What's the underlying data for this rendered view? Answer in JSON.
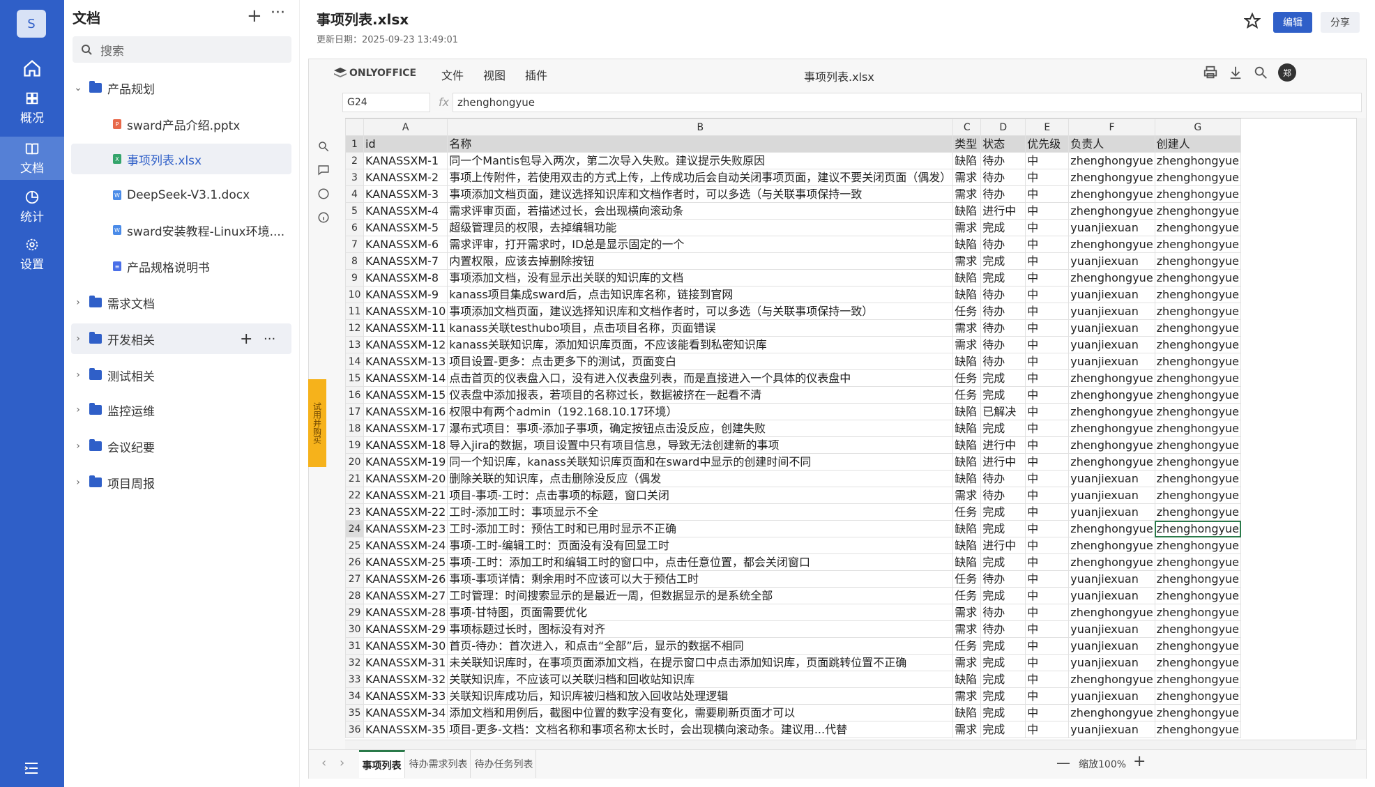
{
  "nav": {
    "logo": "S",
    "items": [
      {
        "label": "",
        "icon": "home-icon"
      },
      {
        "label": "概况",
        "icon": "overview-icon"
      },
      {
        "label": "文档",
        "icon": "book-icon"
      },
      {
        "label": "统计",
        "icon": "pie-chart-icon"
      },
      {
        "label": "设置",
        "icon": "gear-icon"
      }
    ]
  },
  "sidebar": {
    "title": "文档",
    "search_placeholder": "搜索",
    "items": [
      {
        "label": "产品规划",
        "type": "folder",
        "expanded": true
      },
      {
        "label": "sward产品介绍.pptx",
        "type": "pptx"
      },
      {
        "label": "事项列表.xlsx",
        "type": "xlsx",
        "selected": true
      },
      {
        "label": "DeepSeek-V3.1.docx",
        "type": "docx"
      },
      {
        "label": "sward安装教程-Linux环境....",
        "type": "docx"
      },
      {
        "label": "产品规格说明书",
        "type": "doc"
      },
      {
        "label": "需求文档",
        "type": "folder"
      },
      {
        "label": "开发相关",
        "type": "folder",
        "hover": true
      },
      {
        "label": "测试相关",
        "type": "folder"
      },
      {
        "label": "监控运维",
        "type": "folder"
      },
      {
        "label": "会议纪要",
        "type": "folder"
      },
      {
        "label": "项目周报",
        "type": "folder"
      }
    ]
  },
  "header": {
    "title": "事项列表.xlsx",
    "date": "更新日期：2025-09-23 13:49:01",
    "edit": "编辑",
    "share": "分享"
  },
  "editor": {
    "brand": "ONLYOFFICE",
    "menu": [
      "文件",
      "视图",
      "插件"
    ],
    "doc_title": "事项列表.xlsx",
    "avatar": "郑",
    "cell_ref": "G24",
    "formula": "zhenghongyue",
    "side_tab": "试用并购买",
    "columns": [
      "A",
      "B",
      "C",
      "D",
      "E",
      "F"
    ],
    "header_row": [
      "id",
      "名称",
      "类型",
      "状态",
      "优先级",
      "负责人",
      "创建人"
    ],
    "rows": [
      [
        "KANASSXM-1",
        "同一个Mantis包导入两次，第二次导入失败。建议提示失败原因",
        "缺陷",
        "待办",
        "中",
        "zhenghongyue",
        "zhenghongyue"
      ],
      [
        "KANASSXM-2",
        "事项上传附件，若使用双击的方式上传，上传成功后会自动关闭事项页面，建议不要关闭页面（偶发）",
        "需求",
        "待办",
        "中",
        "zhenghongyue",
        "zhenghongyue"
      ],
      [
        "KANASSXM-3",
        "事项添加文档页面，建议选择知识库和文档作者时，可以多选（与关联事项保持一致",
        "需求",
        "待办",
        "中",
        "zhenghongyue",
        "zhenghongyue"
      ],
      [
        "KANASSXM-4",
        "需求评审页面，若描述过长，会出现横向滚动条",
        "缺陷",
        "进行中",
        "中",
        "zhenghongyue",
        "zhenghongyue"
      ],
      [
        "KANASSXM-5",
        "超级管理员的权限，去掉编辑功能",
        "需求",
        "完成",
        "中",
        "yuanjiexuan",
        "zhenghongyue"
      ],
      [
        "KANASSXM-6",
        "需求评审，打开需求时，ID总是显示固定的一个",
        "缺陷",
        "待办",
        "中",
        "zhenghongyue",
        "zhenghongyue"
      ],
      [
        "KANASSXM-7",
        "内置权限，应该去掉删除按钮",
        "需求",
        "完成",
        "中",
        "yuanjiexuan",
        "zhenghongyue"
      ],
      [
        "KANASSXM-8",
        "事项添加文档，没有显示出关联的知识库的文档",
        "缺陷",
        "完成",
        "中",
        "zhenghongyue",
        "zhenghongyue"
      ],
      [
        "KANASSXM-9",
        "kanass项目集成sward后，点击知识库名称，链接到官网",
        "缺陷",
        "待办",
        "中",
        "yuanjiexuan",
        "zhenghongyue"
      ],
      [
        "KANASSXM-10",
        "事项添加文档页面，建议选择知识库和文档作者时，可以多选（与关联事项保持一致）",
        "任务",
        "待办",
        "中",
        "yuanjiexuan",
        "zhenghongyue"
      ],
      [
        "KANASSXM-11",
        "kanass关联testhubo项目，点击项目名称，页面错误",
        "需求",
        "待办",
        "中",
        "yuanjiexuan",
        "zhenghongyue"
      ],
      [
        "KANASSXM-12",
        "kanass关联知识库，添加知识库页面，不应该能看到私密知识库",
        "需求",
        "待办",
        "中",
        "yuanjiexuan",
        "zhenghongyue"
      ],
      [
        "KANASSXM-13",
        "项目设置-更多：点击更多下的测试，页面变白",
        "缺陷",
        "待办",
        "中",
        "yuanjiexuan",
        "zhenghongyue"
      ],
      [
        "KANASSXM-14",
        "点击首页的仪表盘入口，没有进入仪表盘列表，而是直接进入一个具体的仪表盘中",
        "任务",
        "完成",
        "中",
        "zhenghongyue",
        "zhenghongyue"
      ],
      [
        "KANASSXM-15",
        "仪表盘中添加报表，若项目的名称过长，数据被挤在一起看不清",
        "任务",
        "完成",
        "中",
        "zhenghongyue",
        "zhenghongyue"
      ],
      [
        "KANASSXM-16",
        "权限中有两个admin（192.168.10.17环境）",
        "缺陷",
        "已解决",
        "中",
        "zhenghongyue",
        "zhenghongyue"
      ],
      [
        "KANASSXM-17",
        "瀑布式项目：事项-添加子事项，确定按钮点击没反应，创建失败",
        "缺陷",
        "完成",
        "中",
        "zhenghongyue",
        "zhenghongyue"
      ],
      [
        "KANASSXM-18",
        "导入jira的数据，项目设置中只有项目信息，导致无法创建新的事项",
        "缺陷",
        "进行中",
        "中",
        "zhenghongyue",
        "zhenghongyue"
      ],
      [
        "KANASSXM-19",
        "同一个知识库，kanass关联知识库页面和在sward中显示的创建时间不同",
        "缺陷",
        "进行中",
        "中",
        "zhenghongyue",
        "zhenghongyue"
      ],
      [
        "KANASSXM-20",
        "删除关联的知识库，点击删除没反应（偶发",
        "缺陷",
        "待办",
        "中",
        "yuanjiexuan",
        "zhenghongyue"
      ],
      [
        "KANASSXM-21",
        "项目-事项-工时：点击事项的标题，窗口关闭",
        "需求",
        "待办",
        "中",
        "yuanjiexuan",
        "zhenghongyue"
      ],
      [
        "KANASSXM-22",
        "工时-添加工时：事项显示不全",
        "任务",
        "完成",
        "中",
        "yuanjiexuan",
        "zhenghongyue"
      ],
      [
        "KANASSXM-23",
        "工时-添加工时：预估工时和已用时显示不正确",
        "缺陷",
        "完成",
        "中",
        "zhenghongyue",
        "zhenghongyue"
      ],
      [
        "KANASSXM-24",
        "事项-工时-编辑工时：页面没有没有回显工时",
        "缺陷",
        "进行中",
        "中",
        "zhenghongyue",
        "zhenghongyue"
      ],
      [
        "KANASSXM-25",
        "事项-工时：添加工时和编辑工时的窗口中，点击任意位置，都会关闭窗口",
        "缺陷",
        "完成",
        "中",
        "zhenghongyue",
        "zhenghongyue"
      ],
      [
        "KANASSXM-26",
        "事项-事项详情：剩余用时不应该可以大于预估工时",
        "任务",
        "待办",
        "中",
        "yuanjiexuan",
        "zhenghongyue"
      ],
      [
        "KANASSXM-27",
        "工时管理：时间搜索显示的是最近一周，但数据显示的是系统全部",
        "任务",
        "完成",
        "中",
        "yuanjiexuan",
        "zhenghongyue"
      ],
      [
        "KANASSXM-28",
        "事项-甘特图，页面需要优化",
        "需求",
        "待办",
        "中",
        "zhenghongyue",
        "zhenghongyue"
      ],
      [
        "KANASSXM-29",
        "事项标题过长时，图标没有对齐",
        "需求",
        "待办",
        "中",
        "yuanjiexuan",
        "zhenghongyue"
      ],
      [
        "KANASSXM-30",
        "首页-待办：首次进入，和点击“全部”后，显示的数据不相同",
        "任务",
        "完成",
        "中",
        "yuanjiexuan",
        "zhenghongyue"
      ],
      [
        "KANASSXM-31",
        "未关联知识库时，在事项页面添加文档，在提示窗口中点击添加知识库，页面跳转位置不正确",
        "需求",
        "完成",
        "中",
        "yuanjiexuan",
        "zhenghongyue"
      ],
      [
        "KANASSXM-32",
        "关联知识库，不应该可以关联归档和回收站知识库",
        "缺陷",
        "完成",
        "中",
        "zhenghongyue",
        "zhenghongyue"
      ],
      [
        "KANASSXM-33",
        "关联知识库成功后，知识库被归档和放入回收站处理逻辑",
        "需求",
        "完成",
        "中",
        "yuanjiexuan",
        "zhenghongyue"
      ],
      [
        "KANASSXM-34",
        "添加文档和用例后，截图中位置的数字没有变化，需要刷新页面才可以",
        "缺陷",
        "完成",
        "中",
        "zhenghongyue",
        "zhenghongyue"
      ],
      [
        "KANASSXM-35",
        "项目-更多-文档：文档名称和事项名称太长时，会出现横向滚动条。建议用...代替",
        "需求",
        "完成",
        "中",
        "yuanjiexuan",
        "zhenghongyue"
      ]
    ],
    "sheet_tabs": [
      "事项列表",
      "待办需求列表",
      "待办任务列表"
    ],
    "zoom": "缩放100%"
  },
  "colors": {
    "nav": "#2f5fc8",
    "accent": "#2f5fc8",
    "sheet_active": "#2a7a4a",
    "trial": "#f6b21b"
  }
}
